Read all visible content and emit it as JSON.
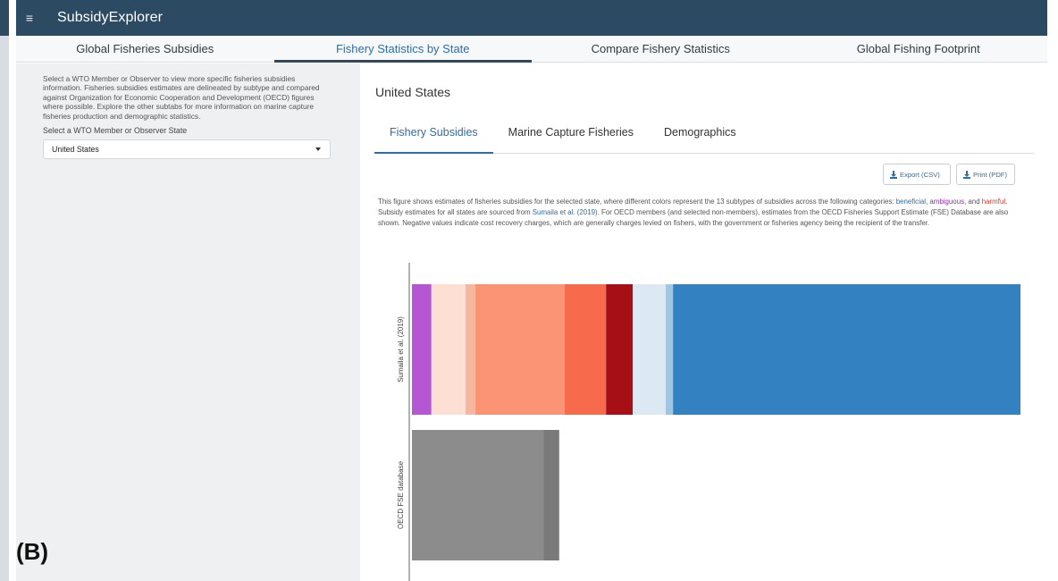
{
  "app": {
    "title": "SubsidyExplorer"
  },
  "main_tabs": [
    {
      "label": "Global Fisheries Subsidies"
    },
    {
      "label": "Fishery Statistics by State"
    },
    {
      "label": "Compare Fishery Statistics"
    },
    {
      "label": "Global Fishing Footprint"
    }
  ],
  "sidebar": {
    "description": "Select a WTO Member or Observer to view more specific fisheries subsidies information. Fisheries subsidies estimates are delineated by subtype and compared against Organization for Economic Cooperation and Development (OECD) figures where possible. Explore the other subtabs for more information on marine capture fisheries production and demographic statistics.",
    "select_label": "Select a WTO Member or Observer State",
    "select_value": "United States"
  },
  "panel_label": "(B)",
  "content": {
    "state_title": "United States",
    "sub_tabs": [
      {
        "label": "Fishery Subsidies"
      },
      {
        "label": "Marine Capture Fisheries"
      },
      {
        "label": "Demographics"
      }
    ],
    "buttons": {
      "export_csv": "Export (CSV)",
      "print_pdf": "Print (PDF)"
    },
    "description": {
      "part1": "This figure shows estimates of fisheries subsidies for the selected state, where different colors represent the 13 subtypes of subsidies across the following categories: ",
      "beneficial": "beneficial",
      "part2": ", ",
      "ambiguous": "ambiguous",
      "part3": ", and ",
      "harmful": "harmful",
      "part4": ". Subsidy estimates for all states are sourced from ",
      "sumaila_link": "Sumaila et al. (2019)",
      "part5": ". For OECD members (and selected non-members), estimates from the OECD Fisheries Support Estimate (FSE) Database are also shown. Negative values indicate cost recovery charges, which are generally charges levied on fishers, with the government or fisheries agency being the recipient of the transfer."
    }
  },
  "chart_data": {
    "type": "bar",
    "orientation": "horizontal",
    "stacked": true,
    "categories": [
      "Sumaila et al. (2019)",
      "OECD FSE database"
    ],
    "xlim": [
      0,
      100
    ],
    "series": [
      {
        "color": "#b557d3",
        "values": [
          3.2,
          0
        ]
      },
      {
        "color": "#fde0d3",
        "values": [
          5.6,
          0
        ]
      },
      {
        "color": "#f6b7a0",
        "values": [
          1.6,
          0
        ]
      },
      {
        "color": "#fb9474",
        "values": [
          14.7,
          0
        ]
      },
      {
        "color": "#f76a4c",
        "values": [
          6.8,
          0
        ]
      },
      {
        "color": "#a50f15",
        "values": [
          4.4,
          0
        ]
      },
      {
        "color": "#dce9f5",
        "values": [
          5.4,
          0
        ]
      },
      {
        "color": "#9fc6e3",
        "values": [
          1.2,
          0
        ]
      },
      {
        "color": "#3381c0",
        "values": [
          57.1,
          0
        ]
      },
      {
        "color": "#8c8c8c",
        "values": [
          0,
          21.6
        ]
      },
      {
        "color": "#7a7a7a",
        "values": [
          0,
          2.6
        ]
      }
    ]
  }
}
